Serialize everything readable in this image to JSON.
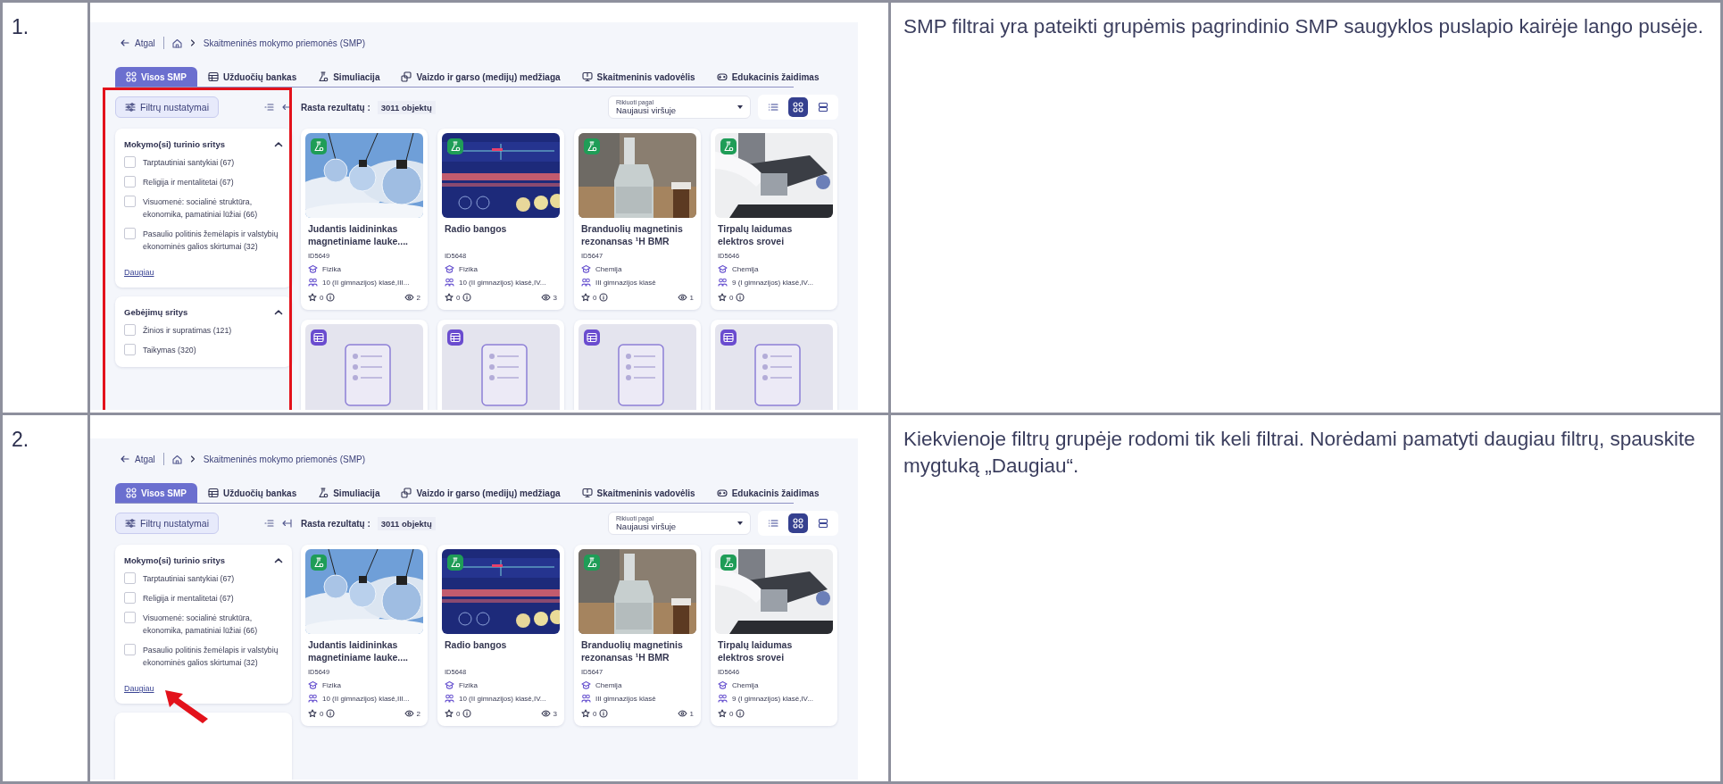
{
  "rows": [
    {
      "number": "1.",
      "description": "SMP filtrai yra pateikti grupėmis pagrindinio SMP saugyklos puslapio kairėje lango pusėje.",
      "screenshot": {
        "breadcrumb": {
          "back": "Atgal",
          "current": "Skaitmeninės mokymo priemonės (SMP)"
        },
        "tabs": [
          {
            "label": "Visos SMP",
            "selected": true
          },
          {
            "label": "Užduočių bankas",
            "selected": false
          },
          {
            "label": "Simuliacija",
            "selected": false
          },
          {
            "label": "Vaizdo ir garso (medijų) medžiaga",
            "selected": false
          },
          {
            "label": "Skaitmeninis vadovėlis",
            "selected": false
          },
          {
            "label": "Edukacinis žaidimas",
            "selected": false
          }
        ],
        "filter_button": "Filtrų nustatymai",
        "results_label": "Rasta rezultatų :",
        "results_count": "3011 objektų",
        "sort": {
          "label": "Rikiuoti pagal",
          "value": "Naujausi viršuje"
        },
        "view_modes": [
          {
            "selected": false
          },
          {
            "selected": true
          },
          {
            "selected": false
          }
        ],
        "filter_groups": [
          {
            "title": "Mokymo(si) turinio sritys",
            "expanded": true,
            "options": [
              {
                "label": "Tarptautiniai santykiai (67)",
                "checked": false
              },
              {
                "label": "Religija ir mentalitetai (67)",
                "checked": false
              },
              {
                "label": "Visuomenė: socialinė struktūra, ekonomika, pamatiniai lūžiai (66)",
                "checked": false
              },
              {
                "label": "Pasaulio politinis žemėlapis ir valstybių ekonominės galios skirtumai (32)",
                "checked": false
              }
            ],
            "more_link": "Daugiau"
          },
          {
            "title": "Gebėjimų sritys",
            "expanded": true,
            "options": [
              {
                "label": "Žinios ir supratimas (121)",
                "checked": false
              },
              {
                "label": "Taikymas (320)",
                "checked": false
              }
            ]
          }
        ],
        "cards": [
          {
            "kind": "simulation",
            "title": "Judantis laidininkas magnetiniame lauke....",
            "id": "ID5649",
            "subject": "Fizika",
            "grades": "10 (II gimnazijos) klasė,III...",
            "rating": "0",
            "views": "2"
          },
          {
            "kind": "simulation",
            "title": "Radio bangos",
            "id": "ID5648",
            "subject": "Fizika",
            "grades": "10 (II gimnazijos) klasė,IV...",
            "rating": "0",
            "views": "3"
          },
          {
            "kind": "simulation",
            "title": "Branduolių magnetinis rezonansas ¹H BMR",
            "id": "ID5647",
            "subject": "Chemija",
            "grades": "III gimnazijos klasė",
            "rating": "0",
            "views": "1"
          },
          {
            "kind": "simulation",
            "title": "Tirpalų laidumas elektros srovei",
            "id": "ID5646",
            "subject": "Chemija",
            "grades": "9 (I gimnazijos) klasė,IV...",
            "rating": "0"
          },
          {
            "kind": "task"
          },
          {
            "kind": "task"
          },
          {
            "kind": "task"
          },
          {
            "kind": "task"
          }
        ],
        "annotation": {
          "kind": "frame",
          "color": "#e3121b"
        }
      }
    },
    {
      "number": "2.",
      "description": "Kiekvienoje filtrų grupėje rodomi tik keli filtrai. Norėdami pamatyti daugiau filtrų, spauskite mygtuką „Daugiau“.",
      "screenshot": {
        "breadcrumb": {
          "back": "Atgal",
          "current": "Skaitmeninės mokymo priemonės (SMP)"
        },
        "tabs": [
          {
            "label": "Visos SMP",
            "selected": true
          },
          {
            "label": "Užduočių bankas",
            "selected": false
          },
          {
            "label": "Simuliacija",
            "selected": false
          },
          {
            "label": "Vaizdo ir garso (medijų) medžiaga",
            "selected": false
          },
          {
            "label": "Skaitmeninis vadovėlis",
            "selected": false
          },
          {
            "label": "Edukacinis žaidimas",
            "selected": false
          }
        ],
        "filter_button": "Filtrų nustatymai",
        "results_label": "Rasta rezultatų :",
        "results_count": "3011 objektų",
        "sort": {
          "label": "Rikiuoti pagal",
          "value": "Naujausi viršuje"
        },
        "view_modes": [
          {
            "selected": false
          },
          {
            "selected": true
          },
          {
            "selected": false
          }
        ],
        "filter_groups": [
          {
            "title": "Mokymo(si) turinio sritys",
            "expanded": true,
            "options": [
              {
                "label": "Tarptautiniai santykiai (67)",
                "checked": false
              },
              {
                "label": "Religija ir mentalitetai (67)",
                "checked": false
              },
              {
                "label": "Visuomenė: socialinė struktūra, ekonomika, pamatiniai lūžiai (66)",
                "checked": false
              },
              {
                "label": "Pasaulio politinis žemėlapis ir valstybių ekonominės galios skirtumai (32)",
                "checked": false
              }
            ],
            "more_link": "Daugiau"
          },
          {
            "kind": "empty"
          }
        ],
        "cards": [
          {
            "kind": "simulation",
            "title": "Judantis laidininkas magnetiniame lauke....",
            "id": "ID5649",
            "subject": "Fizika",
            "grades": "10 (II gimnazijos) klasė,III...",
            "rating": "0",
            "views": "2"
          },
          {
            "kind": "simulation",
            "title": "Radio bangos",
            "id": "ID5648",
            "subject": "Fizika",
            "grades": "10 (II gimnazijos) klasė,IV...",
            "rating": "0",
            "views": "3"
          },
          {
            "kind": "simulation",
            "title": "Branduolių magnetinis rezonansas ¹H BMR",
            "id": "ID5647",
            "subject": "Chemija",
            "grades": "III gimnazijos klasė",
            "rating": "0",
            "views": "1"
          },
          {
            "kind": "simulation",
            "title": "Tirpalų laidumas elektros srovei",
            "id": "ID5646",
            "subject": "Chemija",
            "grades": "9 (I gimnazijos) klasė,IV...",
            "rating": "0"
          }
        ],
        "annotation": {
          "kind": "arrow",
          "color": "#e3121b"
        }
      }
    }
  ]
}
